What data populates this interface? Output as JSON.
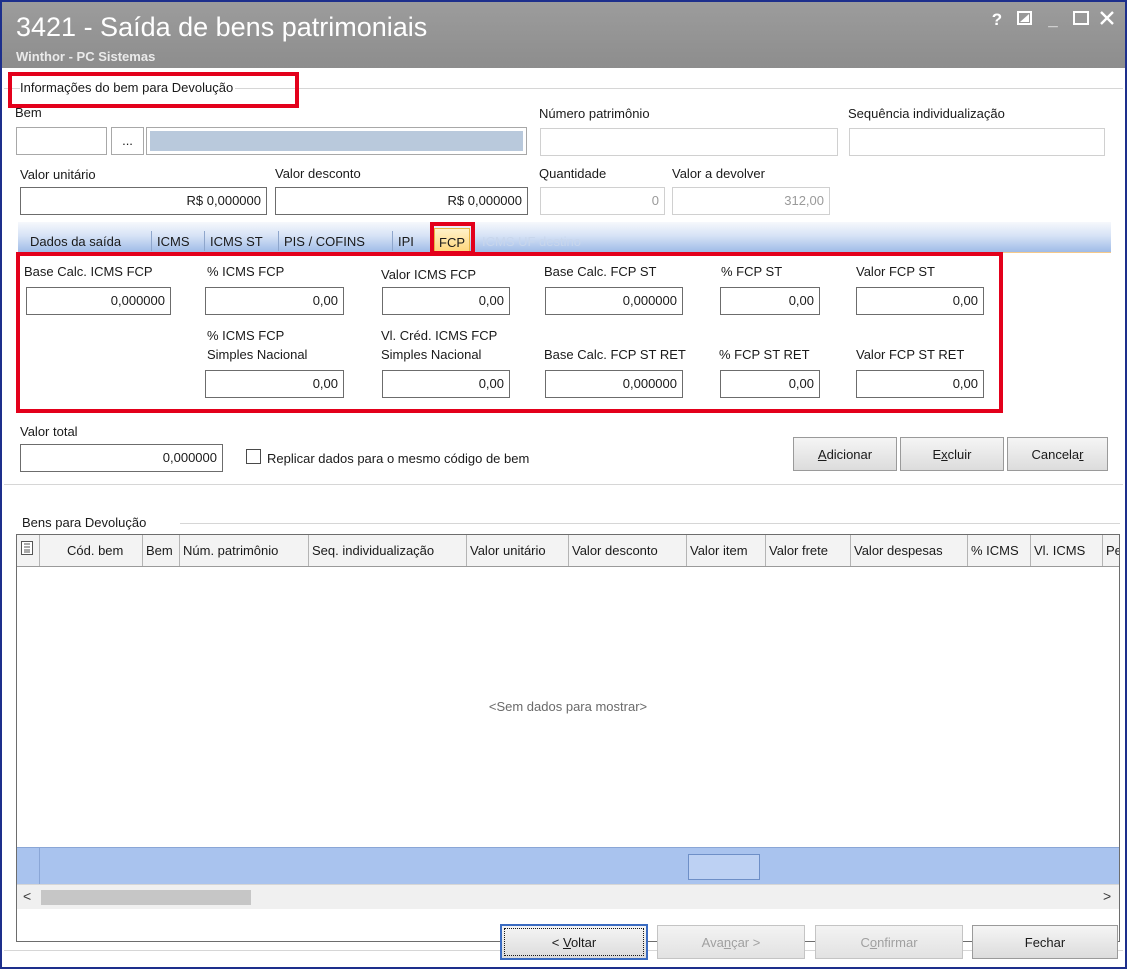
{
  "window": {
    "title": "3421 - Saída de bens patrimoniais",
    "subtitle": "Winthor - PC Sistemas",
    "help_label": "?",
    "minimize_label": "_"
  },
  "info_section": {
    "heading": "Informações do bem para Devolução",
    "bem_label": "Bem",
    "bem_lookup_label": "...",
    "numero_patrimonio_label": "Número patrimônio",
    "sequencia_label": "Sequência individualização",
    "valor_unitario_label": "Valor unitário",
    "valor_unitario_value": "R$ 0,000000",
    "valor_desconto_label": "Valor desconto",
    "valor_desconto_value": "R$ 0,000000",
    "quantidade_label": "Quantidade",
    "quantidade_value": "0",
    "valor_devolver_label": "Valor a devolver",
    "valor_devolver_value": "312,00"
  },
  "tabs": [
    "Dados da saída",
    "ICMS",
    "ICMS ST",
    "PIS / COFINS",
    "IPI",
    "FCP",
    "ICMS UF destino"
  ],
  "active_tab": "FCP",
  "fcp": {
    "base_calc_icms_fcp_label": "Base Calc. ICMS FCP",
    "base_calc_icms_fcp_value": "0,000000",
    "perc_icms_fcp_label": "% ICMS FCP",
    "perc_icms_fcp_value": "0,00",
    "valor_icms_fcp_label": "Valor ICMS FCP",
    "valor_icms_fcp_value": "0,00",
    "base_calc_fcp_st_label": "Base Calc. FCP ST",
    "base_calc_fcp_st_value": "0,000000",
    "perc_fcp_st_label": "% FCP ST",
    "perc_fcp_st_value": "0,00",
    "valor_fcp_st_label": "Valor FCP ST",
    "valor_fcp_st_value": "0,00",
    "perc_icms_fcp_sn_label_1": "% ICMS FCP",
    "perc_icms_fcp_sn_label_2": "Simples Nacional",
    "perc_icms_fcp_sn_value": "0,00",
    "vl_cred_icms_fcp_sn_label_1": "Vl. Créd. ICMS FCP",
    "vl_cred_icms_fcp_sn_label_2": "Simples Nacional",
    "vl_cred_icms_fcp_sn_value": "0,00",
    "base_calc_fcp_st_ret_label": "Base Calc. FCP ST RET",
    "base_calc_fcp_st_ret_value": "0,000000",
    "perc_fcp_st_ret_label": "% FCP ST RET",
    "perc_fcp_st_ret_value": "0,00",
    "valor_fcp_st_ret_label": "Valor FCP ST RET",
    "valor_fcp_st_ret_value": "0,00"
  },
  "totals": {
    "valor_total_label": "Valor total",
    "valor_total_value": "0,000000",
    "replicar_label": "Replicar dados para o mesmo código de bem",
    "replicar_checked": false
  },
  "actions": {
    "adicionar_pre": "",
    "adicionar_key": "A",
    "adicionar_post": "dicionar",
    "excluir_pre": "E",
    "excluir_key": "x",
    "excluir_post": "cluir",
    "cancelar_pre": "Cancela",
    "cancelar_key": "r",
    "cancelar_post": ""
  },
  "grid": {
    "group_label": "Bens para Devolução",
    "columns": [
      "Cód. bem",
      "Bem",
      "Núm. patrimônio",
      "Seq. individualização",
      "Valor unitário",
      "Valor desconto",
      "Valor item",
      "Valor frete",
      "Valor despesas",
      "% ICMS",
      "Vl. ICMS",
      "Pe"
    ],
    "empty_text": "<Sem dados para mostrar>"
  },
  "footer": {
    "voltar_pre": "< ",
    "voltar_key": "V",
    "voltar_post": "oltar",
    "avancar_pre": "Ava",
    "avancar_key": "n",
    "avancar_post": "çar >",
    "confirmar_pre": "C",
    "confirmar_key": "o",
    "confirmar_post": "nfirmar",
    "fechar_label": "Fechar"
  },
  "colors": {
    "highlight": "#e3001b",
    "titlebar": "#959595",
    "tabbar": "#9fbbe7",
    "grid_footer": "#a9c3ee"
  }
}
